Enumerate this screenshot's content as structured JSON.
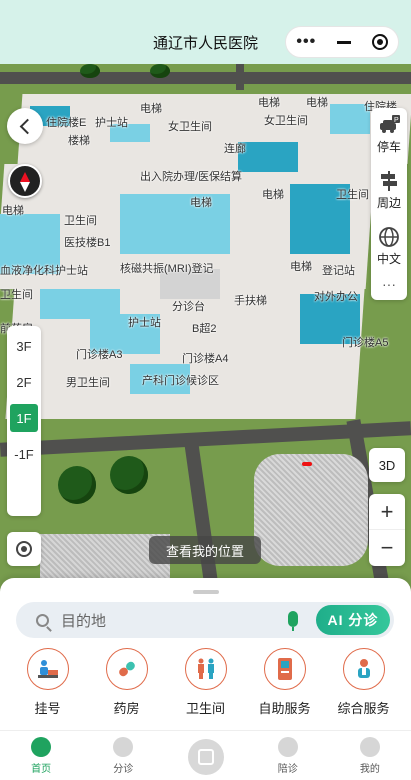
{
  "header": {
    "title": "通辽市人民医院",
    "more_icon": "more-dots-icon",
    "minimize_icon": "minimize-icon",
    "close_icon": "target-icon"
  },
  "map": {
    "labels": [
      {
        "id": "dianti1",
        "text": "电梯"
      },
      {
        "id": "zhuyuanlou",
        "text": "住院楼E"
      },
      {
        "id": "hushizhan1",
        "text": "护士站"
      },
      {
        "id": "louti1",
        "text": "楼梯"
      },
      {
        "id": "weishengjian_f",
        "text": "女卫生间"
      },
      {
        "id": "lianlang",
        "text": "连廊"
      },
      {
        "id": "dianti2",
        "text": "电梯"
      },
      {
        "id": "dianti3",
        "text": "电梯"
      },
      {
        "id": "zhuyuanlou2",
        "text": "住院楼"
      },
      {
        "id": "weishengjian_f2",
        "text": "女卫生间"
      },
      {
        "id": "ruyuan",
        "text": "出入院办理/医保结算"
      },
      {
        "id": "dianti4",
        "text": "电梯"
      },
      {
        "id": "dianti5",
        "text": "电梯"
      },
      {
        "id": "weishengjian2",
        "text": "卫生间"
      },
      {
        "id": "dianti6",
        "text": "电梯"
      },
      {
        "id": "weishengjian3",
        "text": "卫生间"
      },
      {
        "id": "yijilou",
        "text": "医技楼B1"
      },
      {
        "id": "xueye",
        "text": "血液净化科护士站"
      },
      {
        "id": "hecigongzhen",
        "text": "核磁共振(MRI)登记"
      },
      {
        "id": "dianti7",
        "text": "电梯"
      },
      {
        "id": "dengjizhan",
        "text": "登记站"
      },
      {
        "id": "weishengjian4",
        "text": "卫生间"
      },
      {
        "id": "fenzhentai",
        "text": "分诊台"
      },
      {
        "id": "shoufuti",
        "text": "手扶梯"
      },
      {
        "id": "duiwai",
        "text": "对外办公"
      },
      {
        "id": "hushizhan2",
        "text": "护士站"
      },
      {
        "id": "b_chao",
        "text": "B超2"
      },
      {
        "id": "menzhenlou_a5",
        "text": "门诊楼A5"
      },
      {
        "id": "menzhenlou_a3",
        "text": "门诊楼A3"
      },
      {
        "id": "menzhenlou_a4",
        "text": "门诊楼A4"
      },
      {
        "id": "weishengjian_m",
        "text": "男卫生间"
      },
      {
        "id": "chanke",
        "text": "产科门诊候诊区"
      },
      {
        "id": "yaoban",
        "text": "前药房"
      }
    ],
    "right_panel": [
      {
        "id": "parking",
        "label": "停车",
        "icon": "car-parking-icon"
      },
      {
        "id": "nearby",
        "label": "周边",
        "icon": "signpost-icon"
      },
      {
        "id": "language",
        "label": "中文",
        "icon": "globe-icon"
      }
    ],
    "more_label": "···",
    "floors": [
      "3F",
      "2F",
      "1F",
      "-1F"
    ],
    "active_floor": "1F",
    "view_3d_label": "3D",
    "zoom_in": "+",
    "zoom_out": "−",
    "my_location_label": "查看我的位置"
  },
  "search": {
    "placeholder": "目的地",
    "ai_label": "AI 分诊"
  },
  "services": [
    {
      "id": "register",
      "label": "挂号",
      "icon": "register-icon"
    },
    {
      "id": "pharmacy",
      "label": "药房",
      "icon": "pill-icon"
    },
    {
      "id": "restroom",
      "label": "卫生间",
      "icon": "restroom-icon"
    },
    {
      "id": "self_service",
      "label": "自助服务",
      "icon": "kiosk-icon"
    },
    {
      "id": "general_service",
      "label": "综合服务",
      "icon": "service-staff-icon"
    }
  ],
  "tabbar": [
    {
      "id": "home",
      "label": "首页",
      "active": true
    },
    {
      "id": "triage",
      "label": "分诊",
      "active": false
    },
    {
      "id": "center",
      "label": "",
      "active": false
    },
    {
      "id": "escort",
      "label": "陪诊",
      "active": false
    },
    {
      "id": "mine",
      "label": "我的",
      "active": false
    }
  ],
  "colors": {
    "accent": "#1fa35f",
    "header_bg": "#d6f2ea",
    "ai_button": "#2bbf93",
    "service_ring": "#e06b4a"
  }
}
